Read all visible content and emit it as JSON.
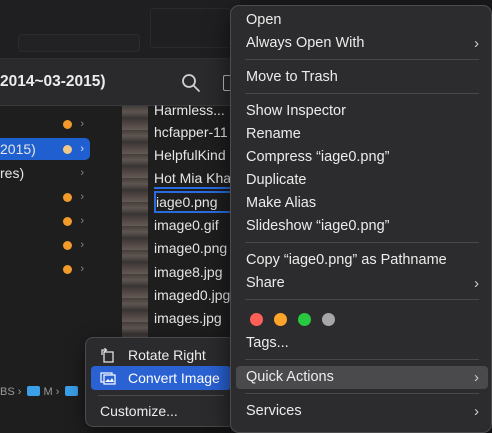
{
  "finder": {
    "title": "2014~03-2015)",
    "sidebar": [
      {
        "label": "",
        "dot": true
      },
      {
        "label": "2015)",
        "dot": true,
        "selected": true
      },
      {
        "label": "res)",
        "dot": false
      },
      {
        "label": "",
        "dot": true
      },
      {
        "label": "",
        "dot": true
      },
      {
        "label": "",
        "dot": true
      },
      {
        "label": "",
        "dot": true
      }
    ],
    "files": [
      "Harmless...",
      "hcfapper-11",
      "HelpfulKind",
      "Hot Mia Kha",
      "iage0.png",
      "image0.gif",
      "image0.png",
      "image8.jpg",
      "imaged0.jpg",
      "images.jpg"
    ],
    "pathbar": {
      "seg1": "BS",
      "seg2": "M",
      "sep": "›"
    }
  },
  "context_menu": {
    "items": [
      {
        "label": "Open"
      },
      {
        "label": "Always Open With",
        "submenu": true
      },
      {
        "label": "Move to Trash"
      },
      {
        "label": "Show Inspector"
      },
      {
        "label": "Rename"
      },
      {
        "label": "Compress “iage0.png”"
      },
      {
        "label": "Duplicate"
      },
      {
        "label": "Make Alias"
      },
      {
        "label": "Slideshow “iage0.png”"
      },
      {
        "label": "Copy “iage0.png” as Pathname"
      },
      {
        "label": "Share",
        "submenu": true
      },
      {
        "label": "Tags..."
      },
      {
        "label": "Quick Actions",
        "submenu": true
      },
      {
        "label": "Services",
        "submenu": true
      }
    ],
    "tag_colors": [
      "#ff5f57",
      "#ffa42b",
      "#28c840",
      "#a7a7a9"
    ]
  },
  "quick_actions": {
    "items": [
      {
        "label": "Rotate Right",
        "icon": "rotate-right-icon"
      },
      {
        "label": "Convert Image",
        "icon": "convert-image-icon"
      },
      {
        "label": "Customize..."
      }
    ]
  },
  "chevron_glyph": "›"
}
